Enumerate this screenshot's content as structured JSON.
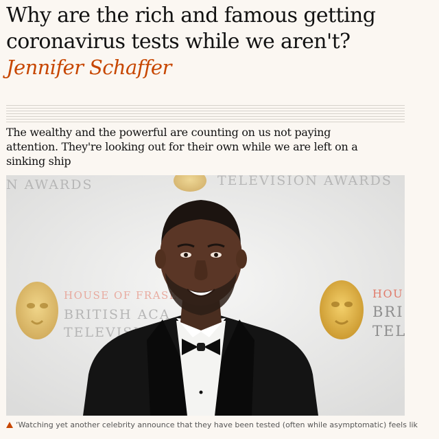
{
  "article": {
    "headline": "Why are the rich and famous getting coronavirus tests while we aren't?",
    "byline": "Jennifer Schaffer",
    "standfirst": "The wealthy and the powerful are counting on us not paying attention. They're looking out for their own while we are left on a sinking ship",
    "photo": {
      "backdrop_left_top": "N AWARDS",
      "backdrop_top": "TELEVISION AWARDS",
      "backdrop_left_red": "HOUSE OF FRASER",
      "backdrop_left_lines": [
        "BRITISH ACA",
        "TELEVISI"
      ],
      "backdrop_right_red": "HOU",
      "backdrop_right_lines": [
        "BRI",
        "TEL"
      ]
    },
    "caption": "‘Watching yet another celebrity announce that they have been tested (often while asymptomatic) feels like"
  },
  "colors": {
    "background": "#fbf7f2",
    "byline": "#c74600",
    "text": "#121212",
    "caption": "#555555"
  },
  "icons": {
    "caption_marker": "triangle-up-icon"
  }
}
